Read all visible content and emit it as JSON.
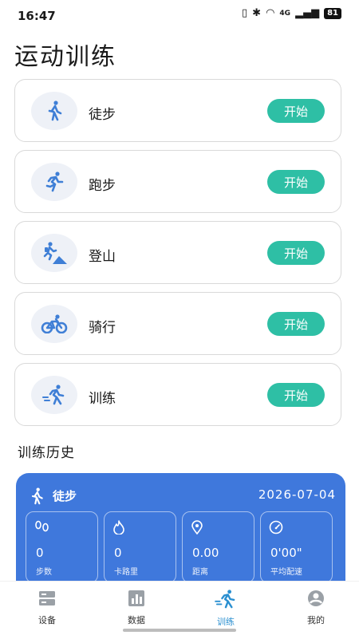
{
  "status_bar": {
    "time": "16:47",
    "network": "4G",
    "battery": "81"
  },
  "page_title": "运动训练",
  "activities": [
    {
      "label": "徒步",
      "button": "开始",
      "icon": "walking-icon"
    },
    {
      "label": "跑步",
      "button": "开始",
      "icon": "running-icon"
    },
    {
      "label": "登山",
      "button": "开始",
      "icon": "hiking-icon"
    },
    {
      "label": "骑行",
      "button": "开始",
      "icon": "cycling-icon"
    },
    {
      "label": "训练",
      "button": "开始",
      "icon": "training-icon"
    }
  ],
  "history": {
    "title": "训练历史",
    "card": {
      "type": "徒步",
      "date": "2026-07-04",
      "stats": [
        {
          "value": "0",
          "label": "步数",
          "icon": "footprint-icon"
        },
        {
          "value": "0",
          "label": "卡路里",
          "icon": "flame-icon"
        },
        {
          "value": "0.00",
          "label": "距离",
          "icon": "location-pin-icon"
        },
        {
          "value": "0'00\"",
          "label": "平均配速",
          "icon": "speedometer-icon"
        }
      ]
    }
  },
  "tabs": [
    {
      "label": "设备",
      "icon": "device-icon",
      "active": false
    },
    {
      "label": "数据",
      "icon": "data-chart-icon",
      "active": false
    },
    {
      "label": "训练",
      "icon": "training-icon",
      "active": true
    },
    {
      "label": "我的",
      "icon": "profile-icon",
      "active": false
    }
  ],
  "colors": {
    "accent_teal": "#2ebfa5",
    "history_blue": "#3f78dc",
    "icon_blue": "#3f7fd6",
    "active_tab": "#2a8fd0"
  }
}
